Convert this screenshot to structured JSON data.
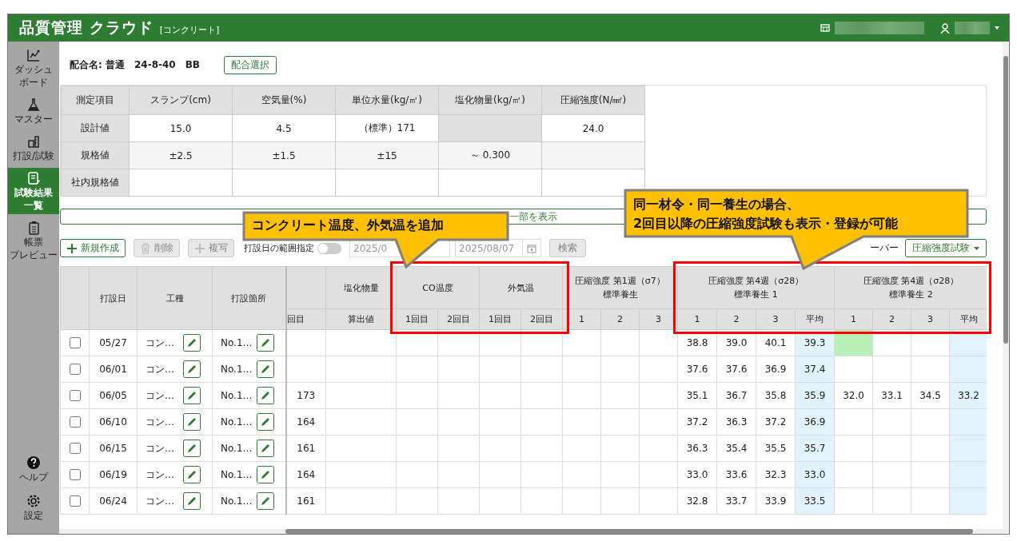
{
  "header": {
    "title": "品質管理 クラウド",
    "subtitle": "[コンクリート]"
  },
  "sidebar": {
    "items": [
      {
        "label": [
          "ダッシュ",
          "ボード"
        ],
        "selected": false
      },
      {
        "label": [
          "マスター"
        ],
        "selected": false
      },
      {
        "label": [
          "打設/試験"
        ],
        "selected": false
      },
      {
        "label": [
          "試験結果",
          "一覧"
        ],
        "selected": true
      },
      {
        "label": [
          "帳票",
          "プレビュー"
        ],
        "selected": false
      }
    ],
    "footer_items": [
      {
        "label": [
          "ヘルプ"
        ],
        "selected": false
      },
      {
        "label": [
          "設定"
        ],
        "selected": false
      }
    ]
  },
  "mix": {
    "name": "配合名: 普通　24-8-40　BB",
    "select_button": "配合選択"
  },
  "spec_table": {
    "corner_label": "測定項目",
    "columns": [
      "スランプ(cm)",
      "空気量(%)",
      "単位水量(kg/㎥)",
      "塩化物量(kg/㎥)",
      "圧縮強度(N/㎟)"
    ],
    "rows": [
      {
        "label": "設計値",
        "cells": [
          {
            "text": "15.0",
            "disabled": false
          },
          {
            "text": "4.5",
            "disabled": false
          },
          {
            "text": "（標準）171",
            "disabled": false
          },
          {
            "disabled": true
          },
          {
            "text": "24.0",
            "disabled": false
          }
        ]
      },
      {
        "label": "規格値",
        "cells": [
          {
            "text": "±2.5",
            "disabled": false
          },
          {
            "text": "±1.5",
            "disabled": false
          },
          {
            "text": "±15",
            "disabled": false
          },
          {
            "text": "～ 0.300",
            "disabled": false
          },
          {
            "disabled": false
          }
        ]
      },
      {
        "label": "社内規格値",
        "cells": [
          {
            "disabled": false
          },
          {
            "disabled": false
          },
          {
            "disabled": false
          },
          {
            "disabled": false
          },
          {
            "disabled": false
          }
        ]
      }
    ]
  },
  "show_part_bar": {
    "label": "一部を表示"
  },
  "toolbar": {
    "buttons": [
      {
        "label": "新規作成",
        "disabled": false
      },
      {
        "label": "削除",
        "disabled": true
      },
      {
        "label": "複写",
        "disabled": true
      }
    ],
    "range_toggle": {
      "label": "打設日の範囲指定",
      "on": false
    },
    "date_from": {
      "value": "2025/0"
    },
    "date_to": {
      "value": "2025/08/07"
    },
    "search": {
      "label": "検索",
      "disabled": true
    },
    "column_set_label": "ーバー",
    "column_set": {
      "value": "圧縮強度試験"
    }
  },
  "table": {
    "fixed_columns": [
      "打設日",
      "工種",
      "打設箇所"
    ],
    "groups": [
      {
        "sub": [
          {
            "label": "回目",
            "kind": "value"
          }
        ]
      },
      {
        "label": [
          "塩化物量"
        ],
        "sub": [
          {
            "label": "算出値",
            "kind": "value"
          }
        ]
      },
      {
        "label": [
          "CO温度"
        ],
        "sub": [
          {
            "label": "1回目",
            "kind": "value"
          },
          {
            "label": "2回目",
            "kind": "value"
          }
        ]
      },
      {
        "label": [
          "外気温"
        ],
        "sub": [
          {
            "label": "1回目",
            "kind": "value"
          },
          {
            "label": "2回目",
            "kind": "value"
          }
        ]
      },
      {
        "label": [
          "圧縮強度 第1週（σ7）",
          "標準養生"
        ],
        "sub": [
          {
            "label": "1",
            "kind": "value"
          },
          {
            "label": "2",
            "kind": "value"
          },
          {
            "label": "3",
            "kind": "value"
          }
        ]
      },
      {
        "label": [
          "圧縮強度 第4週（σ28）",
          "標準養生 1"
        ],
        "sub": [
          {
            "label": "1",
            "kind": "value"
          },
          {
            "label": "2",
            "kind": "value"
          },
          {
            "label": "3",
            "kind": "value"
          },
          {
            "label": "平均",
            "kind": "average"
          }
        ]
      },
      {
        "label": [
          "圧縮強度 第4週（σ28）",
          "標準養生 2"
        ],
        "sub": [
          {
            "label": "1",
            "kind": "value"
          },
          {
            "label": "2",
            "kind": "value"
          },
          {
            "label": "3",
            "kind": "value"
          },
          {
            "label": "平均",
            "kind": "average"
          }
        ]
      }
    ],
    "rows": [
      {
        "checked": false,
        "date": "05/27",
        "work": "コン…",
        "place": "No.1…",
        "cells": [
          {
            "selected": false
          },
          {
            "selected": false
          },
          {
            "selected": false
          },
          {
            "selected": false
          },
          {
            "selected": false
          },
          {
            "selected": false
          },
          {
            "selected": false
          },
          {
            "selected": false
          },
          {
            "selected": false
          },
          {
            "text": "38.8",
            "selected": false
          },
          {
            "text": "39.0",
            "selected": false
          },
          {
            "text": "40.1",
            "selected": false
          },
          {
            "text": "39.3",
            "selected": false
          },
          {
            "selected": true
          },
          {
            "selected": false
          },
          {
            "selected": false
          },
          {
            "selected": false
          }
        ]
      },
      {
        "checked": false,
        "date": "06/01",
        "work": "コン…",
        "place": "No.1…",
        "cells": [
          {
            "selected": false
          },
          {
            "selected": false
          },
          {
            "selected": false
          },
          {
            "selected": false
          },
          {
            "selected": false
          },
          {
            "selected": false
          },
          {
            "selected": false
          },
          {
            "selected": false
          },
          {
            "selected": false
          },
          {
            "text": "37.6",
            "selected": false
          },
          {
            "text": "37.6",
            "selected": false
          },
          {
            "text": "36.9",
            "selected": false
          },
          {
            "text": "37.4",
            "selected": false
          },
          {
            "selected": false
          },
          {
            "selected": false
          },
          {
            "selected": false
          },
          {
            "selected": false
          }
        ]
      },
      {
        "checked": false,
        "date": "06/05",
        "work": "コン…",
        "place": "No.1…",
        "cells": [
          {
            "text": "173",
            "selected": false
          },
          {
            "selected": false
          },
          {
            "selected": false
          },
          {
            "selected": false
          },
          {
            "selected": false
          },
          {
            "selected": false
          },
          {
            "selected": false
          },
          {
            "selected": false
          },
          {
            "selected": false
          },
          {
            "text": "35.1",
            "selected": false
          },
          {
            "text": "36.7",
            "selected": false
          },
          {
            "text": "35.8",
            "selected": false
          },
          {
            "text": "35.9",
            "selected": false
          },
          {
            "text": "32.0",
            "selected": false
          },
          {
            "text": "33.1",
            "selected": false
          },
          {
            "text": "34.5",
            "selected": false
          },
          {
            "text": "33.2",
            "selected": false
          }
        ]
      },
      {
        "checked": false,
        "date": "06/10",
        "work": "コン…",
        "place": "No.1…",
        "cells": [
          {
            "text": "164",
            "selected": false
          },
          {
            "selected": false
          },
          {
            "selected": false
          },
          {
            "selected": false
          },
          {
            "selected": false
          },
          {
            "selected": false
          },
          {
            "selected": false
          },
          {
            "selected": false
          },
          {
            "selected": false
          },
          {
            "text": "37.2",
            "selected": false
          },
          {
            "text": "36.3",
            "selected": false
          },
          {
            "text": "37.2",
            "selected": false
          },
          {
            "text": "36.9",
            "selected": false
          },
          {
            "selected": false
          },
          {
            "selected": false
          },
          {
            "selected": false
          },
          {
            "selected": false
          }
        ]
      },
      {
        "checked": false,
        "date": "06/15",
        "work": "コン…",
        "place": "No.1…",
        "cells": [
          {
            "text": "161",
            "selected": false
          },
          {
            "selected": false
          },
          {
            "selected": false
          },
          {
            "selected": false
          },
          {
            "selected": false
          },
          {
            "selected": false
          },
          {
            "selected": false
          },
          {
            "selected": false
          },
          {
            "selected": false
          },
          {
            "text": "36.3",
            "selected": false
          },
          {
            "text": "35.4",
            "selected": false
          },
          {
            "text": "35.5",
            "selected": false
          },
          {
            "text": "35.7",
            "selected": false
          },
          {
            "selected": false
          },
          {
            "selected": false
          },
          {
            "selected": false
          },
          {
            "selected": false
          }
        ]
      },
      {
        "checked": false,
        "date": "06/19",
        "work": "コン…",
        "place": "No.1…",
        "cells": [
          {
            "text": "164",
            "selected": false
          },
          {
            "selected": false
          },
          {
            "selected": false
          },
          {
            "selected": false
          },
          {
            "selected": false
          },
          {
            "selected": false
          },
          {
            "selected": false
          },
          {
            "selected": false
          },
          {
            "selected": false
          },
          {
            "text": "33.0",
            "selected": false
          },
          {
            "text": "33.6",
            "selected": false
          },
          {
            "text": "32.3",
            "selected": false
          },
          {
            "text": "33.0",
            "selected": false
          },
          {
            "selected": false
          },
          {
            "selected": false
          },
          {
            "selected": false
          },
          {
            "selected": false
          }
        ]
      },
      {
        "checked": false,
        "date": "06/24",
        "work": "コン…",
        "place": "No.1…",
        "cells": [
          {
            "text": "161",
            "selected": false
          },
          {
            "selected": false
          },
          {
            "selected": false
          },
          {
            "selected": false
          },
          {
            "selected": false
          },
          {
            "selected": false
          },
          {
            "selected": false
          },
          {
            "selected": false
          },
          {
            "selected": false
          },
          {
            "text": "32.8",
            "selected": false
          },
          {
            "text": "33.7",
            "selected": false
          },
          {
            "text": "33.9",
            "selected": false
          },
          {
            "text": "33.5",
            "selected": false
          },
          {
            "selected": false
          },
          {
            "selected": false
          },
          {
            "selected": false
          },
          {
            "selected": false
          }
        ]
      }
    ]
  },
  "callouts": [
    {
      "text": "コンクリート温度、外気温を追加"
    },
    {
      "text": "同一材令・同一養生の場合、\n2回目以降の圧縮強度試験も表示・登録が可能"
    }
  ]
}
